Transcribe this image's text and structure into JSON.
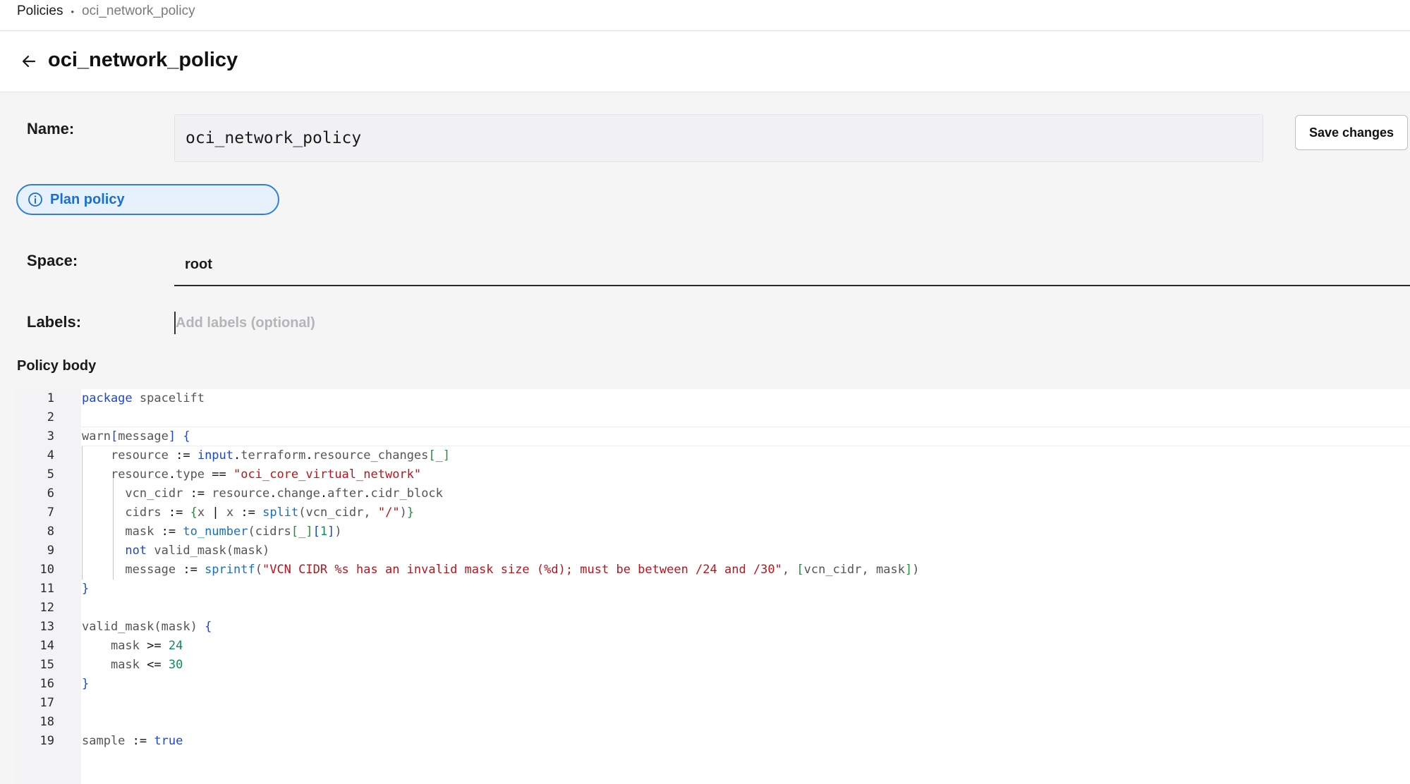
{
  "breadcrumb": {
    "root": "Policies",
    "separator": "•",
    "current": "oci_network_policy"
  },
  "header": {
    "title": "oci_network_policy",
    "back_icon": "arrow-left-icon"
  },
  "form": {
    "name_label": "Name:",
    "name_value": "oci_network_policy",
    "save_label": "Save changes",
    "policy_type": "Plan policy",
    "policy_type_icon": "info-circle-icon",
    "space_label": "Space:",
    "space_value": "root",
    "labels_label": "Labels:",
    "labels_placeholder": "Add labels (optional)",
    "body_title": "Policy body"
  },
  "editor": {
    "active_line": 3,
    "line_numbers": [
      "1",
      "2",
      "3",
      "4",
      "5",
      "6",
      "7",
      "8",
      "9",
      "10",
      "11",
      "12",
      "13",
      "14",
      "15",
      "16",
      "17",
      "18",
      "19"
    ],
    "t": {
      "package": "package",
      "spacelift": "spacelift",
      "warn": "warn",
      "lbr": "[",
      "message": "message",
      "rbr": "]",
      "lbrace": "{",
      "rbrace": "}",
      "resource": "resource",
      "assign": ":=",
      "input": "input",
      "dot": ".",
      "terraform": "terraform",
      "resource_changes": "resource_changes",
      "underscore": "_",
      "type": "type",
      "eq": "==",
      "oci_str": "\"oci_core_virtual_network\"",
      "vcn_cidr": "vcn_cidr",
      "change": "change",
      "after": "after",
      "cidr_block": "cidr_block",
      "cidrs": "cidrs",
      "x": "x",
      "pipe": "|",
      "split": "split",
      "lparen": "(",
      "comma": ",",
      "slash_str": "\"/\"",
      "rparen": ")",
      "mask": "mask",
      "to_number": "to_number",
      "one": "1",
      "not": "not",
      "valid_mask": "valid_mask",
      "sprintf": "sprintf",
      "msg_str": "\"VCN CIDR %s has an invalid mask size (%d); must be between /24 and /30\"",
      "gte": ">=",
      "n24": "24",
      "lte": "<=",
      "n30": "30",
      "sample": "sample",
      "true": "true"
    }
  },
  "colors": {
    "accent_blue": "#2f7fd6",
    "keyword": "#1c46d8",
    "string": "#b8151c",
    "number": "#0f8a5f"
  }
}
